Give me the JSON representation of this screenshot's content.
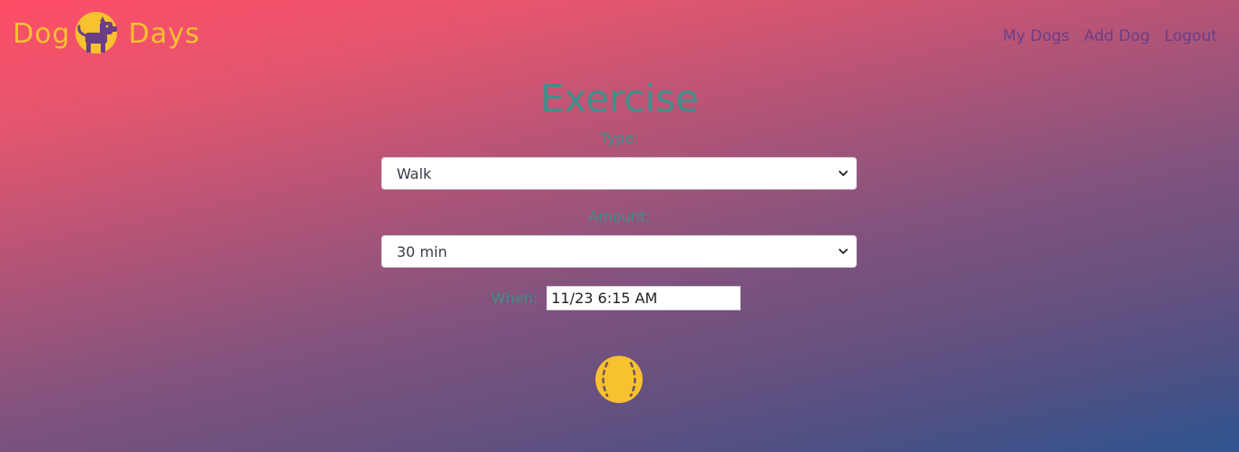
{
  "brand": {
    "word_left": "Dog",
    "word_right": "Days",
    "logo_icon": "dog-sun-logo"
  },
  "nav": {
    "items": [
      {
        "label": "My Dogs"
      },
      {
        "label": "Add Dog"
      },
      {
        "label": "Logout"
      }
    ]
  },
  "form": {
    "title": "Exercise",
    "type_label": "Type:",
    "type_value": "Walk",
    "amount_label": "Amount:",
    "amount_value": "30 min",
    "when_label": "When:",
    "when_value": "11/23 6:15 AM",
    "submit_icon": "tennis-ball-icon"
  },
  "colors": {
    "brand_yellow": "#f8c12f",
    "nav_purple": "#6a3f87",
    "accent_teal": "#3f8f8a",
    "gradient_top": "#ff4d67",
    "gradient_bottom": "#2f5590"
  }
}
